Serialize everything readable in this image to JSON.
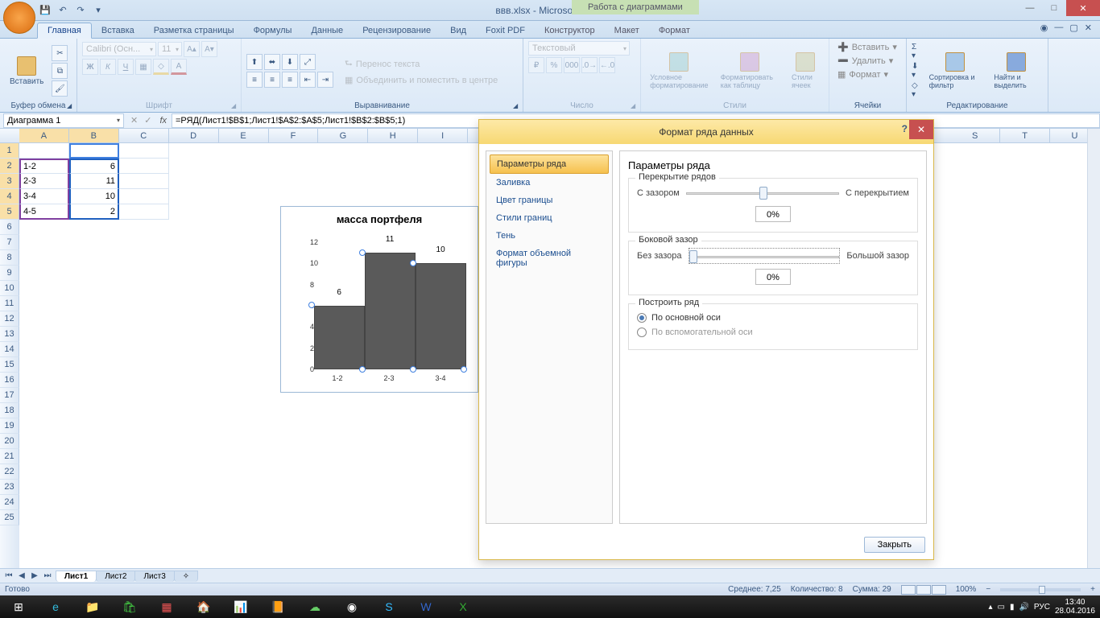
{
  "title": "ввв.xlsx - Microsoft Excel",
  "context_tab_group": "Работа с диаграммами",
  "tabs": [
    "Главная",
    "Вставка",
    "Разметка страницы",
    "Формулы",
    "Данные",
    "Рецензирование",
    "Вид",
    "Foxit PDF"
  ],
  "context_tabs": [
    "Конструктор",
    "Макет",
    "Формат"
  ],
  "ribbon": {
    "clipboard": {
      "paste": "Вставить",
      "label": "Буфер обмена"
    },
    "font": {
      "name": "Calibri (Осн...",
      "size": "11",
      "label": "Шрифт"
    },
    "alignment": {
      "wrap": "Перенос текста",
      "merge": "Объединить и поместить в центре",
      "label": "Выравнивание"
    },
    "number": {
      "format": "Текстовый",
      "label": "Число"
    },
    "styles": {
      "cond": "Условное форматирование",
      "table": "Форматировать как таблицу",
      "cell": "Стили ячеек",
      "label": "Стили"
    },
    "cells": {
      "insert": "Вставить",
      "delete": "Удалить",
      "format": "Формат",
      "label": "Ячейки"
    },
    "editing": {
      "sort": "Сортировка и фильтр",
      "find": "Найти и выделить",
      "label": "Редактирование"
    }
  },
  "namebox": "Диаграмма 1",
  "formula": "=РЯД(Лист1!$B$1;Лист1!$A$2:$A$5;Лист1!$B$2:$B$5;1)",
  "sheet_data": {
    "rows": [
      {
        "a": "",
        "b": ""
      },
      {
        "a": "1-2",
        "b": "6"
      },
      {
        "a": "2-3",
        "b": "11"
      },
      {
        "a": "3-4",
        "b": "10"
      },
      {
        "a": "4-5",
        "b": "2"
      }
    ]
  },
  "chart_data": {
    "type": "bar",
    "title": "масса портфеля",
    "categories": [
      "1-2",
      "2-3",
      "3-4",
      "4-5"
    ],
    "values": [
      6,
      11,
      10,
      2
    ],
    "y_ticks": [
      0,
      2,
      4,
      6,
      8,
      10,
      12
    ],
    "ylim": [
      0,
      12
    ],
    "visible_categories": [
      "1-2",
      "2-3",
      "3-4"
    ],
    "visible_values": [
      6,
      11,
      10
    ],
    "data_labels": [
      "6",
      "11",
      "10"
    ]
  },
  "dialog": {
    "title": "Формат ряда данных",
    "nav": [
      "Параметры ряда",
      "Заливка",
      "Цвет границы",
      "Стили границ",
      "Тень",
      "Формат объемной фигуры"
    ],
    "heading": "Параметры ряда",
    "overlap": {
      "legend": "Перекрытие рядов",
      "left": "С зазором",
      "right": "С перекрытием",
      "value": "0%"
    },
    "gap": {
      "legend": "Боковой зазор",
      "left": "Без зазора",
      "right": "Большой зазор",
      "value": "0%"
    },
    "plot_on": {
      "legend": "Построить ряд",
      "primary": "По основной оси",
      "secondary": "По вспомогательной оси"
    },
    "close": "Закрыть"
  },
  "sheets": [
    "Лист1",
    "Лист2",
    "Лист3"
  ],
  "status": {
    "ready": "Готово",
    "avg": "Среднее: 7,25",
    "count": "Количество: 8",
    "sum": "Сумма: 29",
    "zoom": "100%"
  },
  "tray": {
    "lang": "РУС",
    "time": "13:40",
    "date": "28.04.2016"
  }
}
